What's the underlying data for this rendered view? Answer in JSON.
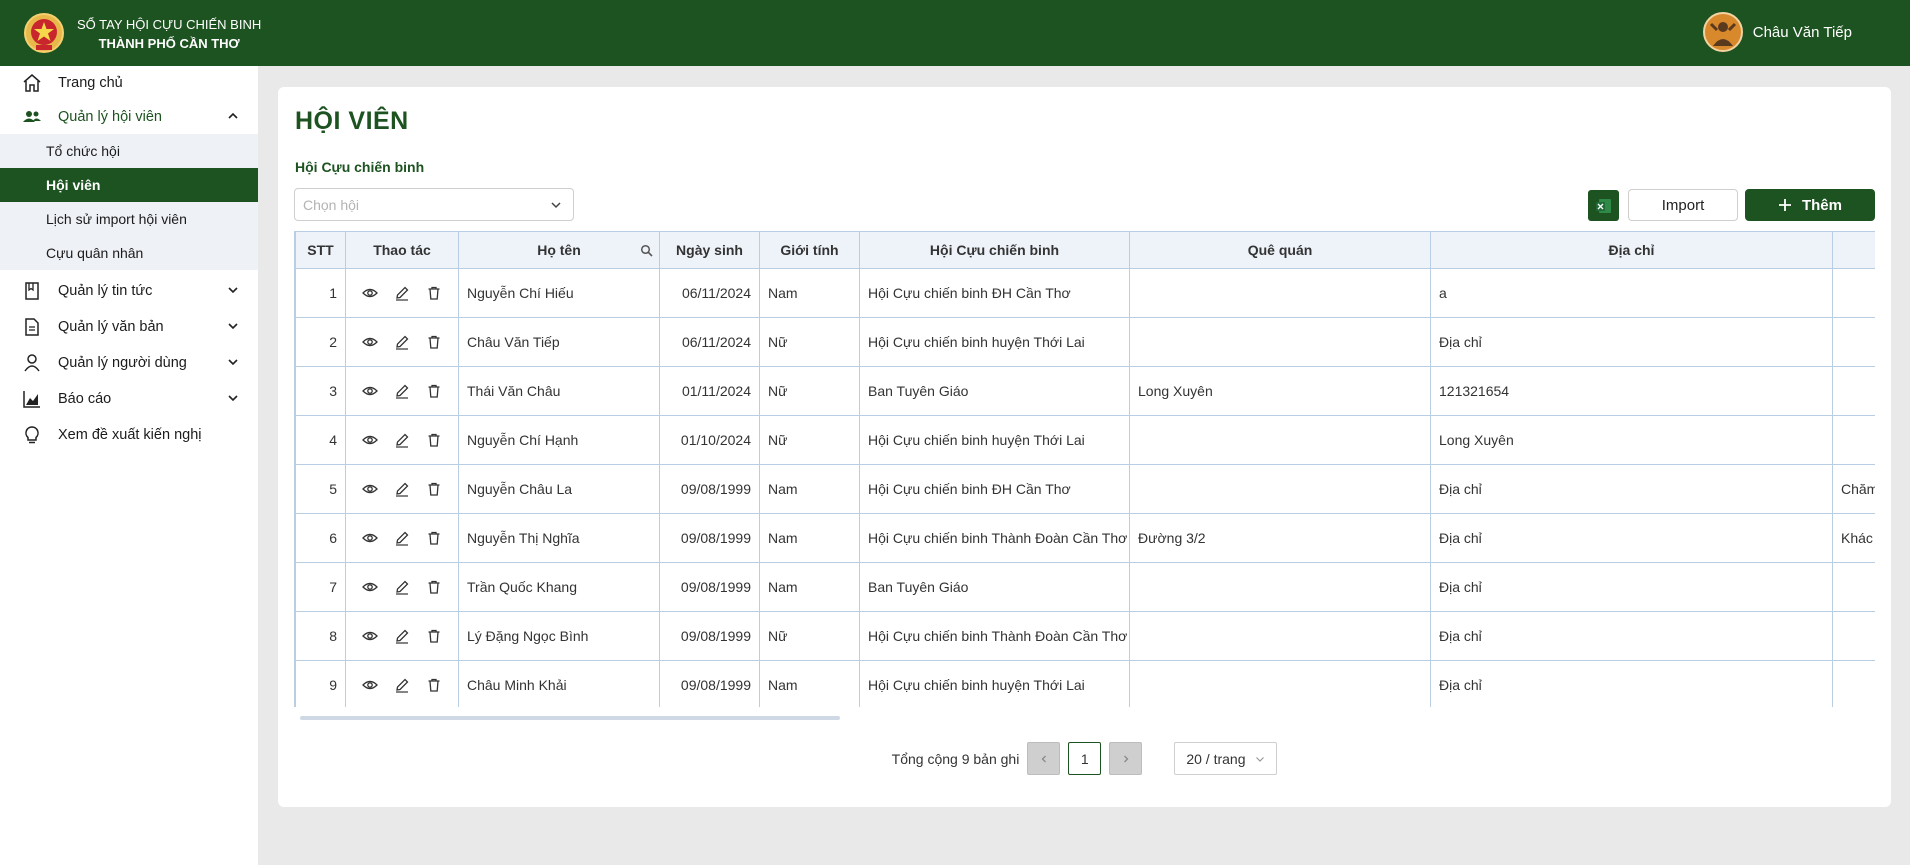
{
  "header": {
    "brand_line1": "SỔ TAY HỘI CỰU CHIẾN BINH",
    "brand_line2": "THÀNH PHỐ CẦN THƠ",
    "user_name": "Châu Văn Tiếp"
  },
  "sidebar": {
    "items": [
      {
        "label": "Trang chủ",
        "icon": "home-icon"
      },
      {
        "label": "Quản lý hội viên",
        "icon": "users-icon"
      },
      {
        "label": "Quản lý tin tức",
        "icon": "book-icon"
      },
      {
        "label": "Quản lý văn bản",
        "icon": "document-icon"
      },
      {
        "label": "Quản lý người dùng",
        "icon": "user-icon"
      },
      {
        "label": "Báo cáo",
        "icon": "chart-icon"
      },
      {
        "label": "Xem đề xuất kiến nghị",
        "icon": "lightbulb-icon"
      }
    ],
    "sub_items": [
      "Tổ chức hội",
      "Hội viên",
      "Lịch sử import hội viên",
      "Cựu quân nhân"
    ]
  },
  "page": {
    "title": "HỘI VIÊN",
    "filter_label": "Hội Cựu chiến binh",
    "select_placeholder": "Chọn hội",
    "import_label": "Import",
    "add_label": "Thêm"
  },
  "table": {
    "columns": [
      "STT",
      "Thao tác",
      "Họ tên",
      "Ngày sinh",
      "Giới tính",
      "Hội Cựu chiến binh",
      "Quê quán",
      "Địa chỉ",
      ""
    ],
    "rows": [
      {
        "stt": "1",
        "name": "Nguyễn Chí Hiếu",
        "dob": "06/11/2024",
        "gender": "Nam",
        "assoc": "Hội Cựu chiến binh ĐH Cần Thơ",
        "hometown": "",
        "address": "a",
        "extra": ""
      },
      {
        "stt": "2",
        "name": "Châu Văn Tiếp",
        "dob": "06/11/2024",
        "gender": "Nữ",
        "assoc": "Hội Cựu chiến binh huyện Thới Lai",
        "hometown": "",
        "address": "Địa chỉ",
        "extra": ""
      },
      {
        "stt": "3",
        "name": "Thái Văn Châu",
        "dob": "01/11/2024",
        "gender": "Nữ",
        "assoc": "Ban Tuyên Giáo",
        "hometown": "Long Xuyên",
        "address": "121321654",
        "extra": ""
      },
      {
        "stt": "4",
        "name": "Nguyễn Chí Hạnh",
        "dob": "01/10/2024",
        "gender": "Nữ",
        "assoc": "Hội Cựu chiến binh huyện Thới Lai",
        "hometown": "",
        "address": "Long Xuyên",
        "extra": ""
      },
      {
        "stt": "5",
        "name": "Nguyễn Châu La",
        "dob": "09/08/1999",
        "gender": "Nam",
        "assoc": "Hội Cựu chiến binh ĐH Cần Thơ",
        "hometown": "",
        "address": "Địa chỉ",
        "extra": "Chăm"
      },
      {
        "stt": "6",
        "name": "Nguyễn Thị Nghĩa",
        "dob": "09/08/1999",
        "gender": "Nam",
        "assoc": "Hội Cựu chiến binh Thành Đoàn Cần Thơ",
        "hometown": "Đường 3/2",
        "address": "Địa chỉ",
        "extra": "Khác"
      },
      {
        "stt": "7",
        "name": "Trần Quốc Khang",
        "dob": "09/08/1999",
        "gender": "Nam",
        "assoc": "Ban Tuyên Giáo",
        "hometown": "",
        "address": "Địa chỉ",
        "extra": ""
      },
      {
        "stt": "8",
        "name": "Lý Đặng Ngọc Bình",
        "dob": "09/08/1999",
        "gender": "Nữ",
        "assoc": "Hội Cựu chiến binh Thành Đoàn Cần Thơ",
        "hometown": "",
        "address": "Địa chỉ",
        "extra": ""
      },
      {
        "stt": "9",
        "name": "Châu Minh Khải",
        "dob": "09/08/1999",
        "gender": "Nam",
        "assoc": "Hội Cựu chiến binh huyện Thới Lai",
        "hometown": "",
        "address": "Địa chỉ",
        "extra": ""
      }
    ]
  },
  "pagination": {
    "total_text": "Tổng cộng 9 bản ghi",
    "current_page": "1",
    "page_size": "20 / trang"
  },
  "colors": {
    "primary": "#1d5320",
    "header_bg": "#1d5320",
    "table_border": "#b9cde3"
  }
}
